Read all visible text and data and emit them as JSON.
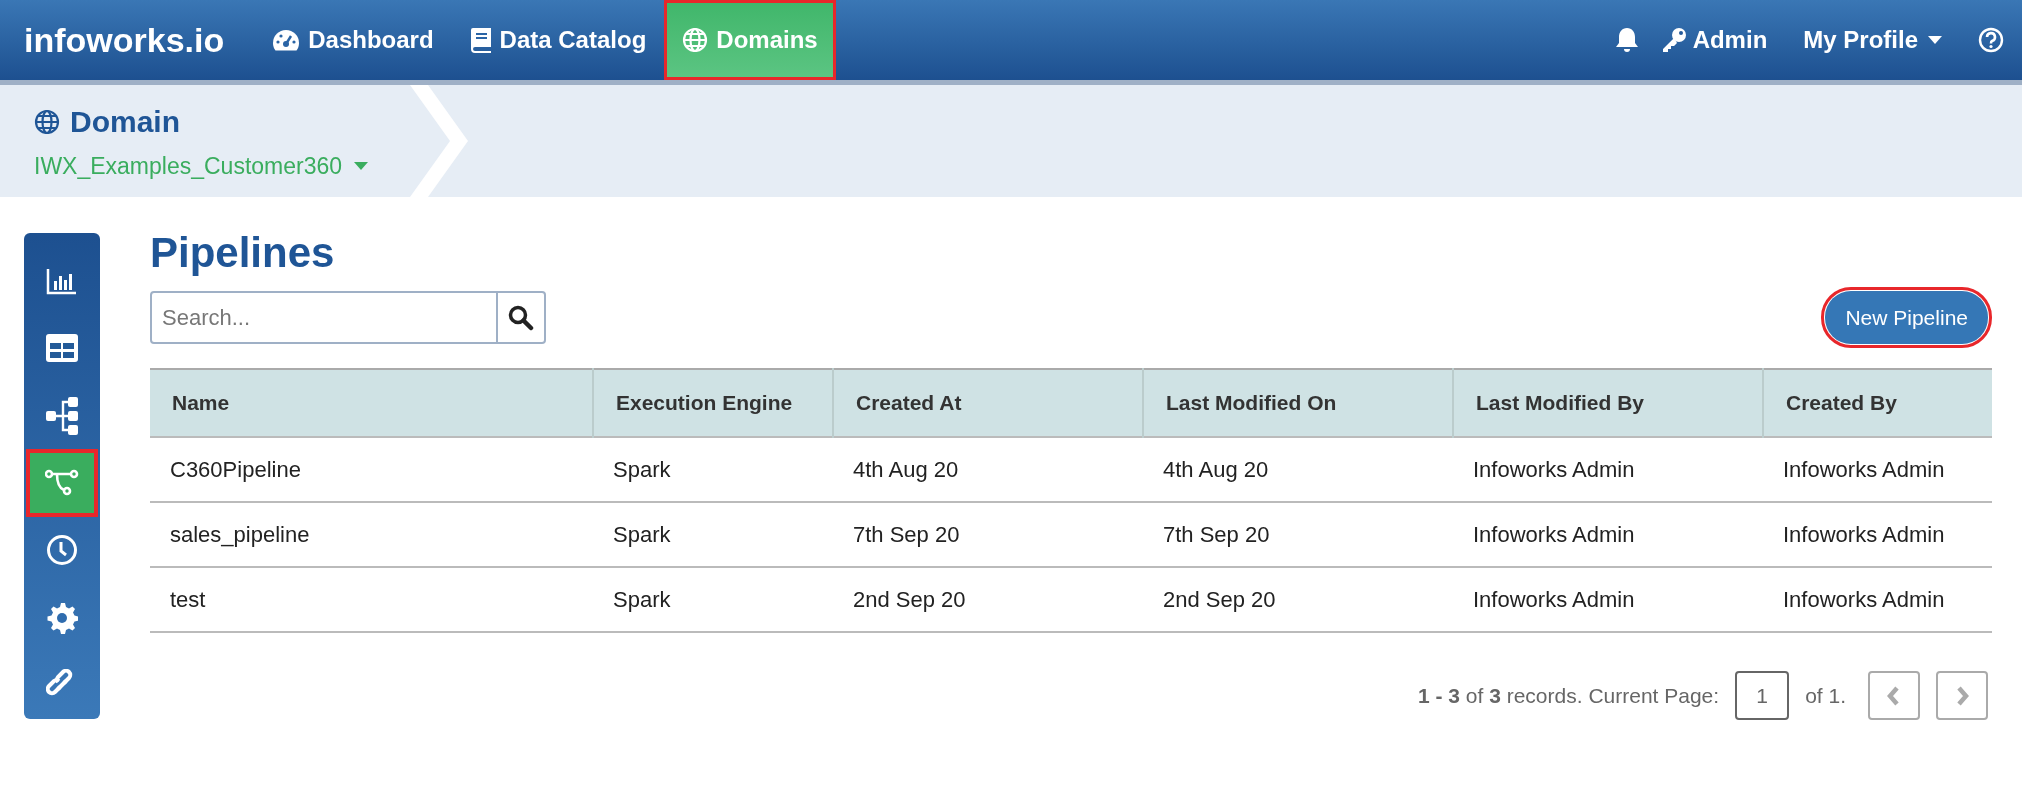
{
  "topbar": {
    "logo": "infoworks.io",
    "nav": [
      {
        "label": "Dashboard",
        "selected": false,
        "highlighted": false
      },
      {
        "label": "Data Catalog",
        "selected": false,
        "highlighted": false
      },
      {
        "label": "Domains",
        "selected": true,
        "highlighted": true
      }
    ],
    "user": "Admin",
    "profile": "My Profile"
  },
  "breadcrumb": {
    "title": "Domain",
    "domain": "IWX_Examples_Customer360"
  },
  "sidebar": {
    "items": [
      {
        "selected": false,
        "highlighted": false
      },
      {
        "selected": false,
        "highlighted": false
      },
      {
        "selected": false,
        "highlighted": false
      },
      {
        "selected": true,
        "highlighted": true
      },
      {
        "selected": false,
        "highlighted": false
      },
      {
        "selected": false,
        "highlighted": false
      },
      {
        "selected": false,
        "highlighted": false
      }
    ]
  },
  "page": {
    "title": "Pipelines",
    "search": {
      "placeholder": "Search..."
    },
    "new_button": {
      "label": "New Pipeline",
      "highlighted": true
    }
  },
  "table": {
    "columns": [
      "Name",
      "Execution Engine",
      "Created At",
      "Last Modified On",
      "Last Modified By",
      "Created By"
    ],
    "rows": [
      [
        "C360Pipeline",
        "Spark",
        "4th Aug 20",
        "4th Aug 20",
        "Infoworks Admin",
        "Infoworks Admin"
      ],
      [
        "sales_pipeline",
        "Spark",
        "7th Sep 20",
        "7th Sep 20",
        "Infoworks Admin",
        "Infoworks Admin"
      ],
      [
        "test",
        "Spark",
        "2nd Sep 20",
        "2nd Sep 20",
        "Infoworks Admin",
        "Infoworks Admin"
      ]
    ]
  },
  "pagination": {
    "summary": "**1 - 3** of **3** records. Current Page:",
    "page": "1",
    "total": "of 1."
  }
}
